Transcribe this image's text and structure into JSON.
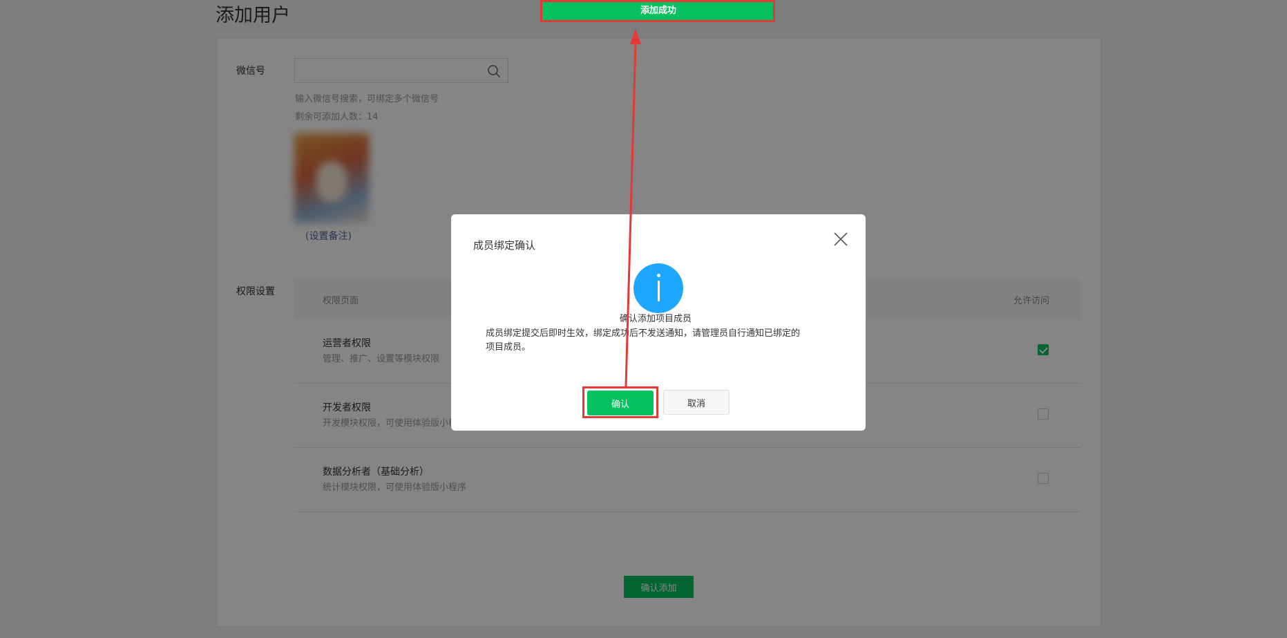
{
  "page": {
    "title": "添加用户",
    "wechat_label": "微信号",
    "search": {
      "value": "",
      "placeholder": ""
    },
    "search_hint": "输入微信号搜索，可绑定多个微信号",
    "remaining_text": "剩余可添加人数：14",
    "set_note_link": "(设置备注)",
    "permission_label": "权限设置",
    "table": {
      "col_page": "权限页面",
      "col_access": "允许访问",
      "rows": [
        {
          "title": "运营者权限",
          "desc": "管理、推广、设置等模块权限",
          "checked": true
        },
        {
          "title": "开发者权限",
          "desc": "开发模块权限，可使用体验版小程序",
          "checked": false
        },
        {
          "title": "数据分析者（基础分析）",
          "desc": "统计模块权限，可使用体验版小程序",
          "checked": false
        }
      ]
    },
    "confirm_add_button": "确认添加"
  },
  "toast": {
    "text": "添加成功"
  },
  "dialog": {
    "title": "成员绑定确认",
    "icon": "info-icon",
    "heading": "确认添加项目成员",
    "body_line1": "成员绑定提交后即时生效，绑定成功后不发送通知，请管理员自行通知已绑定的",
    "body_line2": "项目成员。",
    "ok_button": "确认",
    "cancel_button": "取消"
  },
  "colors": {
    "brand_green": "#07c160",
    "info_blue": "#1ea7ff",
    "highlight_red": "#e53935",
    "link_blue": "#576b95"
  }
}
